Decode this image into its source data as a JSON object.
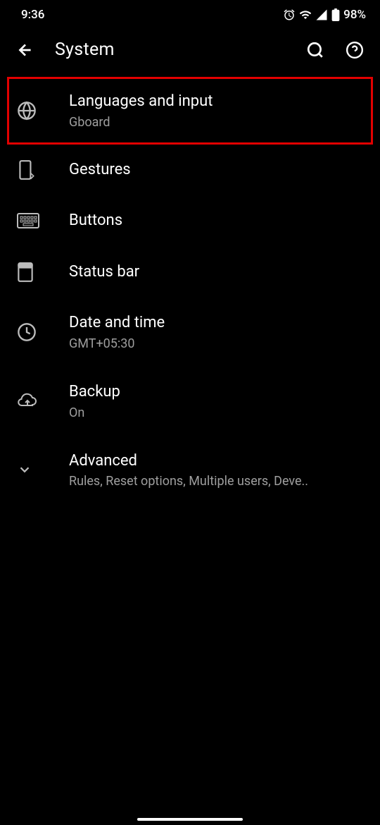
{
  "statusBar": {
    "time": "9:36",
    "battery": "98%"
  },
  "appBar": {
    "title": "System"
  },
  "items": [
    {
      "title": "Languages and input",
      "subtitle": "Gboard"
    },
    {
      "title": "Gestures",
      "subtitle": ""
    },
    {
      "title": "Buttons",
      "subtitle": ""
    },
    {
      "title": "Status bar",
      "subtitle": ""
    },
    {
      "title": "Date and time",
      "subtitle": "GMT+05:30"
    },
    {
      "title": "Backup",
      "subtitle": "On"
    },
    {
      "title": "Advanced",
      "subtitle": "Rules, Reset options, Multiple users, Deve.."
    }
  ]
}
